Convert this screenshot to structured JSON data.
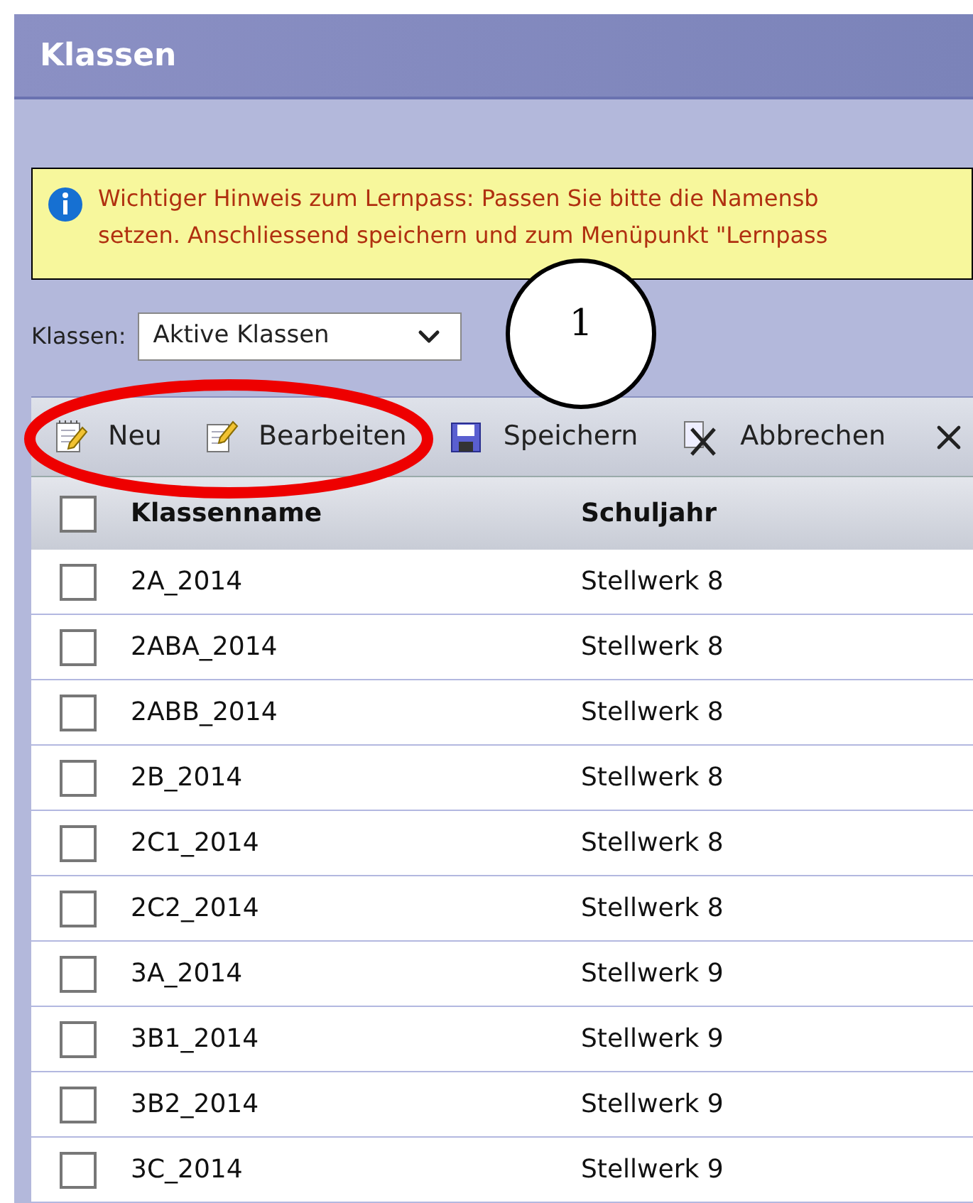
{
  "window": {
    "title": "Klassen"
  },
  "notice": {
    "lines": [
      "Wichtiger Hinweis zum Lernpass: Passen Sie bitte die Namensb",
      "setzen. Anschliessend speichern und zum Menüpunkt \"Lernpass"
    ]
  },
  "filter": {
    "label": "Klassen:",
    "value": "Aktive Klassen"
  },
  "toolbar": [
    {
      "kind": "new",
      "label": "Neu"
    },
    {
      "kind": "edit",
      "label": "Bearbeiten"
    },
    {
      "kind": "save",
      "label": "Speichern"
    },
    {
      "kind": "cancel",
      "label": "Abbrechen"
    },
    {
      "kind": "delete"
    }
  ],
  "table": {
    "select_all": {
      "checked": false
    },
    "columns": [
      "Klassenname",
      "Schuljahr"
    ],
    "rows": [
      {
        "checked": false,
        "cells": [
          "2A_2014",
          "Stellwerk 8"
        ]
      },
      {
        "checked": false,
        "cells": [
          "2ABA_2014",
          "Stellwerk 8"
        ]
      },
      {
        "checked": false,
        "cells": [
          "2ABB_2014",
          "Stellwerk 8"
        ]
      },
      {
        "checked": false,
        "cells": [
          "2B_2014",
          "Stellwerk 8"
        ]
      },
      {
        "checked": false,
        "cells": [
          "2C1_2014",
          "Stellwerk 8"
        ]
      },
      {
        "checked": false,
        "cells": [
          "2C2_2014",
          "Stellwerk 8"
        ]
      },
      {
        "checked": false,
        "cells": [
          "3A_2014",
          "Stellwerk 9"
        ]
      },
      {
        "checked": false,
        "cells": [
          "3B1_2014",
          "Stellwerk 9"
        ]
      },
      {
        "checked": false,
        "cells": [
          "3B2_2014",
          "Stellwerk 9"
        ]
      },
      {
        "checked": false,
        "cells": [
          "3C_2014",
          "Stellwerk 9"
        ]
      }
    ]
  },
  "annotations": [
    {
      "kind": "ellipse"
    },
    {
      "kind": "callout",
      "label": "1"
    }
  ]
}
